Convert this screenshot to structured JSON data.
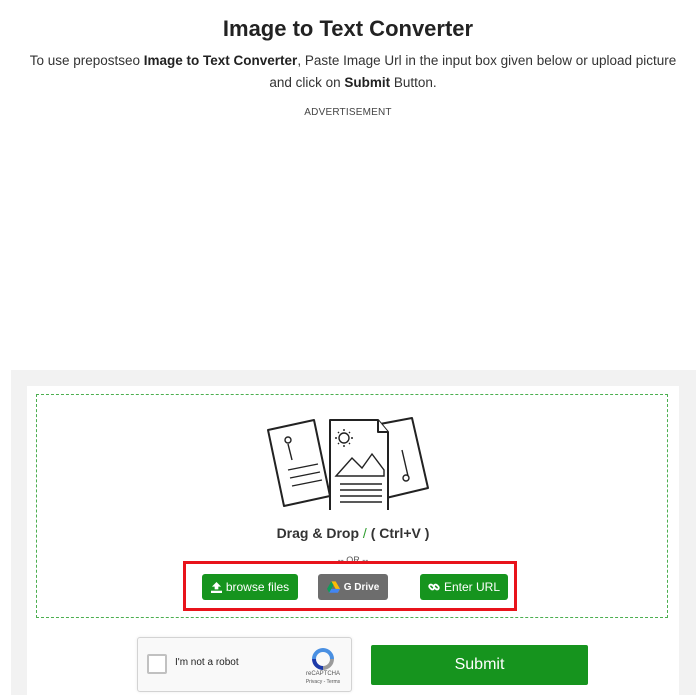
{
  "header": {
    "title": "Image to Text Converter",
    "intro_part1": "To use prepostseo ",
    "intro_bold1": "Image to Text Converter",
    "intro_part2": ", Paste Image Url in the input box given below or upload picture and click on ",
    "intro_bold2": "Submit",
    "intro_part3": " Button.",
    "ad_label": "ADVERTISEMENT"
  },
  "uploader": {
    "illustration_icon": "documents-image-icon",
    "drag_text": "Drag & Drop",
    "drag_slash": "/",
    "drag_shortcut": "( Ctrl+V )",
    "or_text": "-- OR --",
    "browse_label": "browse files",
    "browse_icon": "upload-icon",
    "gdrive_label": "G Drive",
    "gdrive_icon": "google-drive-icon",
    "url_label": "Enter URL",
    "url_icon": "link-icon"
  },
  "recaptcha": {
    "label": "I'm not a robot",
    "brand": "reCAPTCHA",
    "links": "Privacy - Terms"
  },
  "submit": {
    "label": "Submit"
  },
  "colors": {
    "accent_green": "#16941e",
    "highlight_red": "#e8131b",
    "drive_gray": "#6d6d6d",
    "panel_gray": "#f2f2f2"
  }
}
